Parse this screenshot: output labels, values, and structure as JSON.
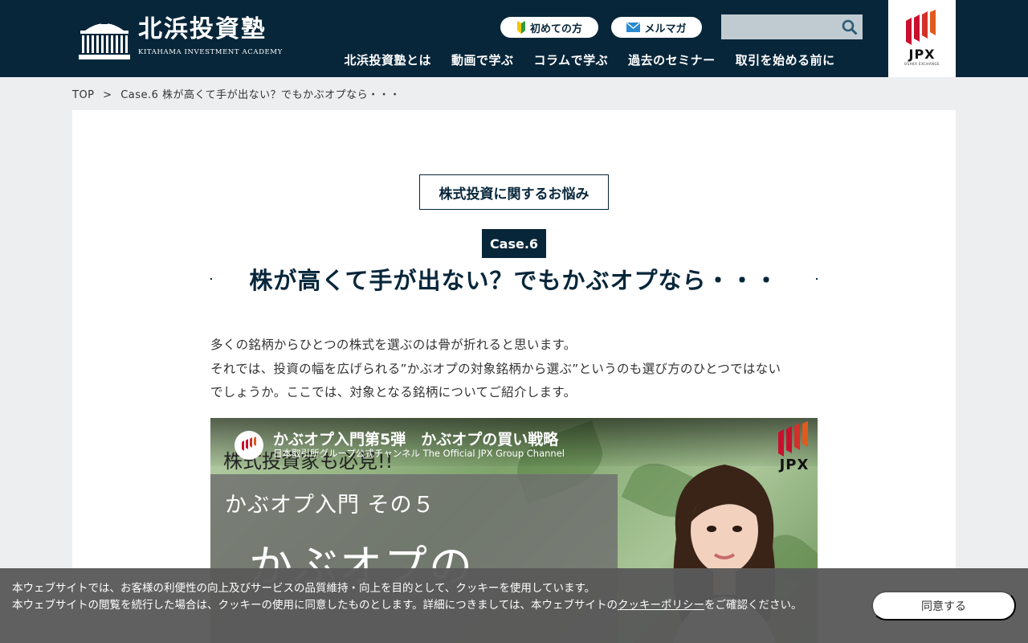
{
  "header": {
    "logo_jp": "北浜投資塾",
    "logo_en": "KITAHAMA INVESTMENT ACADEMY",
    "pill_first": "初めての方",
    "pill_mail": "メルマガ",
    "search_placeholder": "",
    "nav": [
      "北浜投資塾とは",
      "動画で学ぶ",
      "コラムで学ぶ",
      "過去のセミナー",
      "取引を始める前に"
    ],
    "jpx_word": "JPX",
    "jpx_sub": "OSAKA EXCHANGE"
  },
  "breadcrumb": {
    "top": "TOP",
    "sep": ">",
    "current": "Case.6 株が高くて手が出ない？でもかぶオプなら・・・"
  },
  "main": {
    "category": "株式投資に関するお悩み",
    "case": "Case.6",
    "title": "株が高くて手が出ない？でもかぶオプなら・・・",
    "intro": [
      "多くの銘柄からひとつの株式を選ぶのは骨が折れると思います。",
      "それでは、投資の幅を広げられる”かぶオプの対象銘柄から選ぶ”というのも選び方のひとつではない",
      "でしょうか。ここでは、対象となる銘柄についてご紹介します。"
    ]
  },
  "video": {
    "title": "かぶオプ入門第5弾　かぶオプの買い戦略",
    "channel": "日本取引所グループ公式チャンネル The Official JPX Group Channel",
    "overlay": "株式投資家も必見!!",
    "subtitle": "かぶオプ入門 その５",
    "big_text": "かぶオプの",
    "jpx_word": "JPX",
    "channel_icon_word": "JPX"
  },
  "cookie": {
    "line1": "本ウェブサイトでは、お客様の利便性の向上及びサービスの品質維持・向上を目的として、クッキーを使用しています。",
    "line2_pre": "本ウェブサイトの閲覧を続行した場合は、クッキーの使用に同意したものとします。詳細につきましては、本ウェブサイトの",
    "link": "クッキーポリシー",
    "line2_post": "をご確認ください。",
    "button": "同意する"
  },
  "colors": {
    "navy": "#07263a",
    "jpx_red": "#c8102e",
    "cookie_bg": "#5a5a5a"
  }
}
